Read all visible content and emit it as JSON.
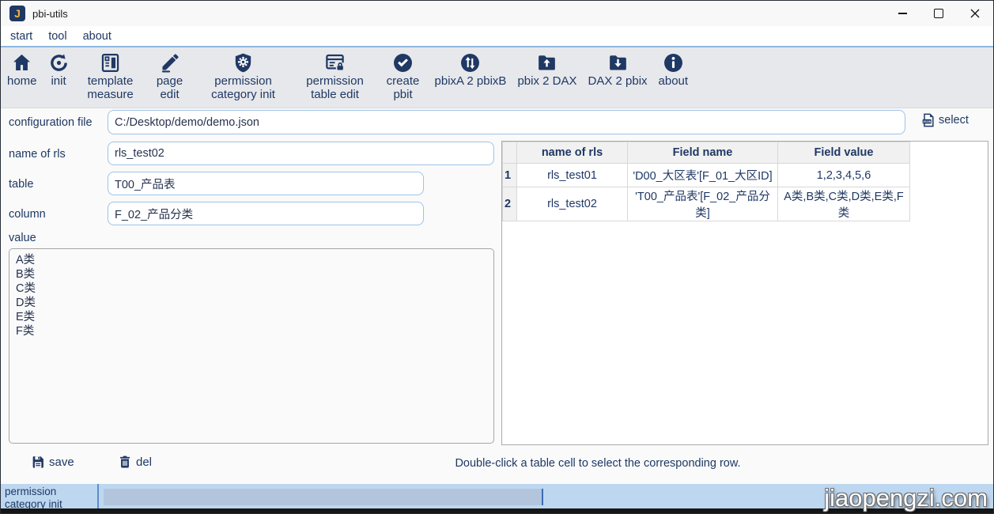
{
  "window": {
    "title": "pbi-utils",
    "app_icon_letter": "J"
  },
  "menu": {
    "items": [
      {
        "label": "start"
      },
      {
        "label": "tool"
      },
      {
        "label": "about"
      }
    ]
  },
  "toolbar": {
    "items": [
      {
        "icon": "home-icon",
        "label": "home"
      },
      {
        "icon": "init-icon",
        "label": "init"
      },
      {
        "icon": "template-measure-icon",
        "label": "template measure"
      },
      {
        "icon": "page-edit-icon",
        "label": "page edit"
      },
      {
        "icon": "permission-category-init-icon",
        "label": "permission category init"
      },
      {
        "icon": "permission-table-edit-icon",
        "label": "permission table edit"
      },
      {
        "icon": "create-pbit-icon",
        "label": "create pbit"
      },
      {
        "icon": "pbixa-2-pbixb-icon",
        "label": "pbixA 2 pbixB"
      },
      {
        "icon": "pbix-2-dax-icon",
        "label": "pbix 2 DAX"
      },
      {
        "icon": "dax-2-pbix-icon",
        "label": "DAX 2 pbix"
      },
      {
        "icon": "about-icon",
        "label": "about"
      }
    ]
  },
  "form": {
    "config_label": "configuration file",
    "config_value": "C:/Desktop/demo/demo.json",
    "select_label": "select",
    "rls_label": "name of rls",
    "rls_value": "rls_test02",
    "table_label": "table",
    "table_value": "T00_产品表",
    "column_label": "column",
    "column_value": "F_02_产品分类",
    "value_label": "value",
    "value_text": "A类\nB类\nC类\nD类\nE类\nF类"
  },
  "rls_table": {
    "headers": [
      "name of rls",
      "Field name",
      "Field value"
    ],
    "rows": [
      {
        "num": "1",
        "name": "rls_test01",
        "field_name": "'D00_大区表'[F_01_大区ID]",
        "field_value": "1,2,3,4,5,6"
      },
      {
        "num": "2",
        "name": "rls_test02",
        "field_name": "'T00_产品表'[F_02_产品分类]",
        "field_value": "A类,B类,C类,D类,E类,F类"
      }
    ]
  },
  "actions": {
    "save_label": "save",
    "del_label": "del",
    "hint": "Double-click a table cell to select the corresponding row."
  },
  "statusbar": {
    "task_label": "permission category init",
    "watermark": "jiaopengzi.com"
  },
  "colors": {
    "navy_accent": "#1f3864",
    "input_border": "#9dc3e6",
    "toolbar_bg": "#e7e8eb",
    "statusbar_bg": "#bdd7f0",
    "progress_fill": "#b2c5dc",
    "app_icon_gold": "#f2b63c"
  }
}
